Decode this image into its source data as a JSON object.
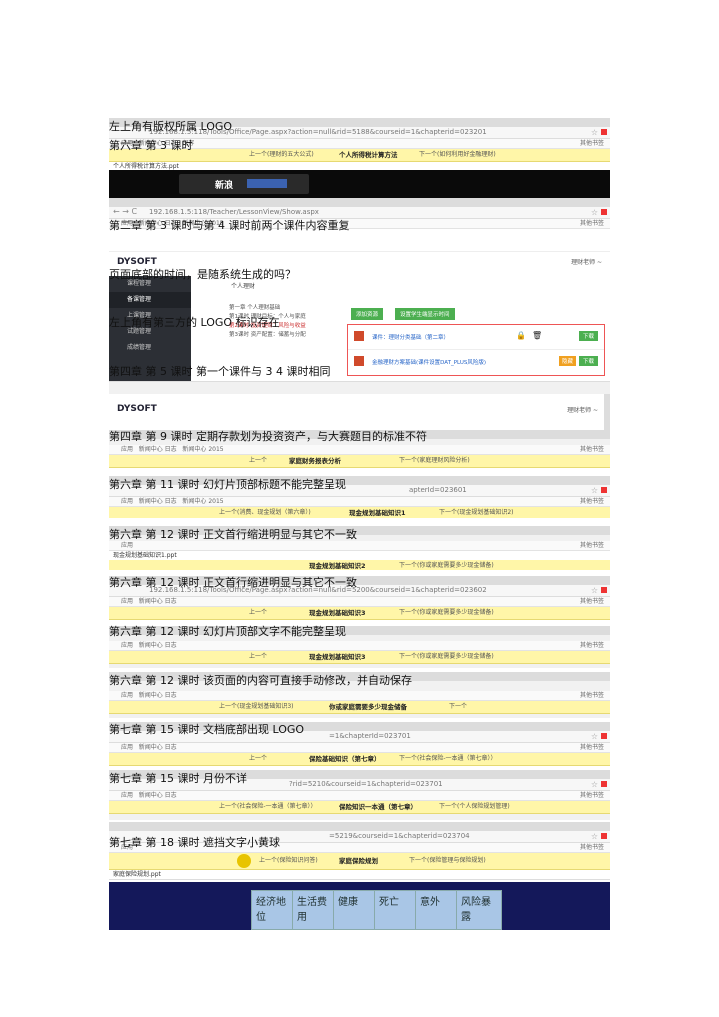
{
  "notes": [
    "左上角有版权所属 LOGO",
    "第六章 第 3 课时",
    "第二章 第 3 课时与第 4 课时前两个课件内容重复",
    "页面底部的时间，是随系统生成的吗？",
    "左上角有第三方的 LOGO 标识存在",
    "第四章 第 5 课时 第一个课件与 3 4 课时相同",
    "第四章 第 9 课时 定期存款划为投资资产，与大赛题目的标准不符",
    "第六章 第 11 课时 幻灯片顶部标题不能完整呈现",
    "第六章 第 12 课时 正文首行缩进明显与其它不一致",
    "第六章 第 12 课时 正文首行缩进明显与其它不一致",
    "第六章 第 12 课时 幻灯片顶部文字不能完整呈现",
    "第六章 第 12 课时 该页面的内容可直接手动修改，并自动保存",
    "第七章 第 15 课时 文档底部出现 LOGO",
    "第七章 第 15 课时 月份不详",
    "第七章 第 18 课时 遮挡文字小黄球"
  ],
  "shots": {
    "s1": {
      "url": "192.168.1.5:118/Tools/Office/Page.aspx?action=null&rid=5188&courseid=1&chapterid=023201",
      "prev": "上一个(理财的五大公式)",
      "cur": "个人所得税计算方法",
      "next": "下一个(如何利用好金融理财)",
      "file": "个人所得税计算方法.ppt",
      "logo": "新浪"
    },
    "s2": {
      "url": "192.168.1.5:118/Teacher/LessonView/Show.aspx",
      "brand": "DYSOFT",
      "user": "理财老师 ~",
      "crumb": "个人理财",
      "side": [
        "课程管理",
        "备课管理",
        "上课管理",
        "试题管理",
        "成绩管理"
      ],
      "btn1": "添加资源",
      "btn2": "设置学生端显示时间",
      "lessons": [
        "第一章 个人理财基础",
        "第1课时 理财目标：个人与家庭",
        "第2课时 投资理财：风险与收益",
        "第3课时 资产配置：储蓄与分配"
      ],
      "res1": "课件：理财分类基础（第二章）",
      "res2": "金融理财方案基础(课件设置DAT_PLUS风险版)",
      "dl": "下载",
      "hide": "隐藏"
    },
    "s3": {
      "brand": "DYSOFT",
      "user": "理财老师 ~"
    },
    "s4": {
      "prev": "上一个",
      "cur": "家庭财务报表分析",
      "next": "下一个(家庭理财风险分析)"
    },
    "s5": {
      "url": "apterId=023601",
      "prev": "上一个(消费、现金规划（第六章）)",
      "cur": "现金规划基础知识1",
      "next": "下一个(现金规划基础知识2)"
    },
    "s6": {
      "file": "现金规划基础知识1.ppt",
      "cur": "现金规划基础知识2",
      "next": "下一个(你或家庭需要多少现金储备)"
    },
    "s7": {
      "url": "192.168.1.5:118/Tools/Office/Page.aspx?action=null&rid=5200&courseid=1&chapterid=023602",
      "prev": "上一个",
      "cur": "现金规划基础知识3",
      "next": "下一个(你或家庭需要多少现金储备)"
    },
    "s8": {
      "prev": "上一个",
      "cur": "现金规划基础知识3",
      "next": "下一个(你或家庭需要多少现金储备)"
    },
    "s9": {
      "prev": "上一个(现金规划基础知识3)",
      "cur": "你或家庭需要多少现金储备",
      "next": "下一个"
    },
    "s10": {
      "url": "=1&chapterId=023701",
      "prev": "上一个",
      "cur": "保险基础知识（第七章）",
      "next": "下一个(社会保险-一本通（第七章））"
    },
    "s11": {
      "url": "?rid=5210&courseid=1&chapterid=023701",
      "prev": "上一个(社会保险-一本通（第七章））",
      "cur": "保险知识一本通（第七章）",
      "next": "下一个(个人保险规划管理)"
    },
    "s12": {
      "url": "=5219&courseid=1&chapterid=023704",
      "prev": "上一个(保险知识问答)",
      "cur": "家庭保险规划",
      "next": "下一个(保险管理与保险规划)",
      "file": "家庭保险规划.ppt",
      "cols": [
        "经济地位",
        "生活费用",
        "健康",
        "死亡",
        "意外",
        "风险暴露"
      ]
    },
    "bm": [
      "应用",
      "新闻中心 日志",
      "新闻中心 日志",
      "保存",
      "新闻中心 2015",
      "C盘理财"
    ],
    "bm_folder": "其他书签"
  }
}
